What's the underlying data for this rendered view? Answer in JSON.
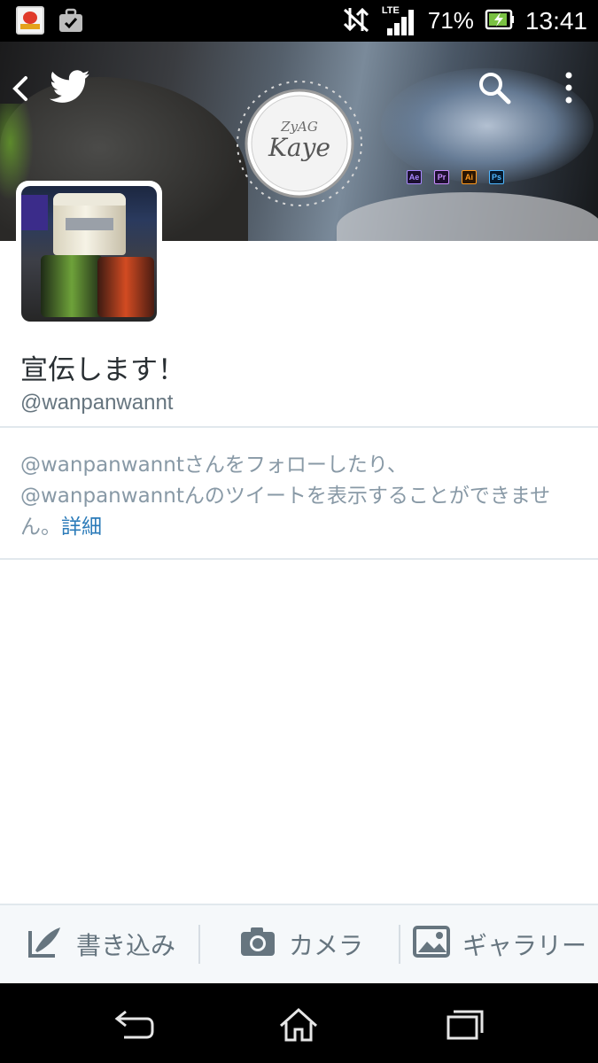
{
  "status_bar": {
    "battery_percent": "71%",
    "time": "13:41",
    "network_label": "LTE"
  },
  "profile": {
    "display_name": "宣伝します！",
    "handle": "@wanpanwannt",
    "banner_logo_line1": "ZyAG",
    "banner_logo_line2": "Kaye",
    "banner_badges": [
      "Ae",
      "Pr",
      "Ai",
      "Ps"
    ]
  },
  "protected_notice": {
    "text": "@wanpanwanntさんをフォローしたり、@wanpanwanntんのツイートを表示することができません。",
    "link_label": "詳細"
  },
  "compose_bar": {
    "write_label": "書き込み",
    "camera_label": "カメラ",
    "gallery_label": "ギャラリー"
  },
  "colors": {
    "link": "#2b7bb9",
    "muted_text": "#8899a6",
    "divider": "#e1e8ed",
    "compose_bg": "#f5f8fa"
  }
}
